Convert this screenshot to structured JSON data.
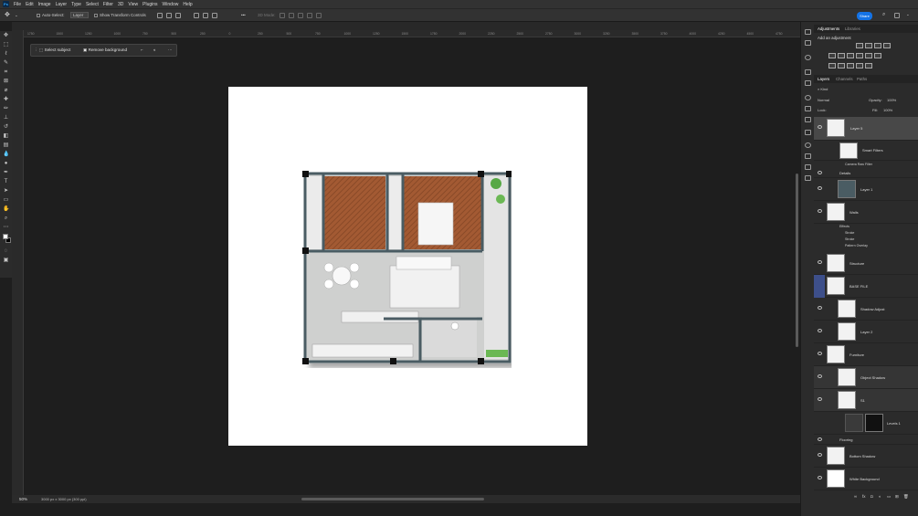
{
  "menu": {
    "app_icon": "Ps",
    "items": [
      "File",
      "Edit",
      "Image",
      "Layer",
      "Type",
      "Select",
      "Filter",
      "3D",
      "View",
      "Plugins",
      "Window",
      "Help"
    ]
  },
  "options": {
    "auto_select": "Auto-Select:",
    "auto_select_target": "Layer",
    "transform_controls": "Show Transform Controls",
    "mode_3d": "3D Mode:",
    "share": "Share"
  },
  "document": {
    "tab_title": "",
    "zoom": "50%",
    "doc_size": "3000 px x 3000 px (300 ppi)"
  },
  "ruler": {
    "ticks": [
      "1750",
      "1500",
      "1250",
      "1000",
      "750",
      "500",
      "250",
      "0",
      "250",
      "500",
      "750",
      "1000",
      "1250",
      "1500",
      "1750",
      "2000",
      "2250",
      "2500",
      "2750",
      "3000",
      "3250",
      "3500",
      "3750",
      "4000",
      "4250",
      "4500",
      "4750"
    ]
  },
  "taskbar": {
    "select_subject": "Select subject",
    "remove_background": "Remove background"
  },
  "adjustments": {
    "tabs": [
      "Adjustments",
      "Libraries"
    ],
    "add_label": "Add an adjustment"
  },
  "layers": {
    "tabs": [
      "Layers",
      "Channels",
      "Paths"
    ],
    "kind": "Kind",
    "blend_mode": "Normal",
    "opacity_label": "Opacity:",
    "opacity": "100%",
    "lock_label": "Lock:",
    "fill_label": "Fill:",
    "fill": "100%",
    "rows": [
      "Layer 5",
      "Smart Filters",
      "Camera Raw Filter",
      "Details",
      "Layer 1",
      "Walls",
      "Effects",
      "Stroke",
      "Stroke",
      "Pattern Overlay",
      "Structure",
      "BASE FILE",
      "Shadow Adjust",
      "Layer 2",
      "Furniture",
      "Object Shadow",
      "S1",
      "Levels 1",
      "Flooring",
      "Bottom Shadow",
      "White Background"
    ]
  },
  "colors": {
    "accent": "#1473e6",
    "wall": "#4a5c63",
    "wood": "#a35a33",
    "canvas": "#ffffff"
  }
}
